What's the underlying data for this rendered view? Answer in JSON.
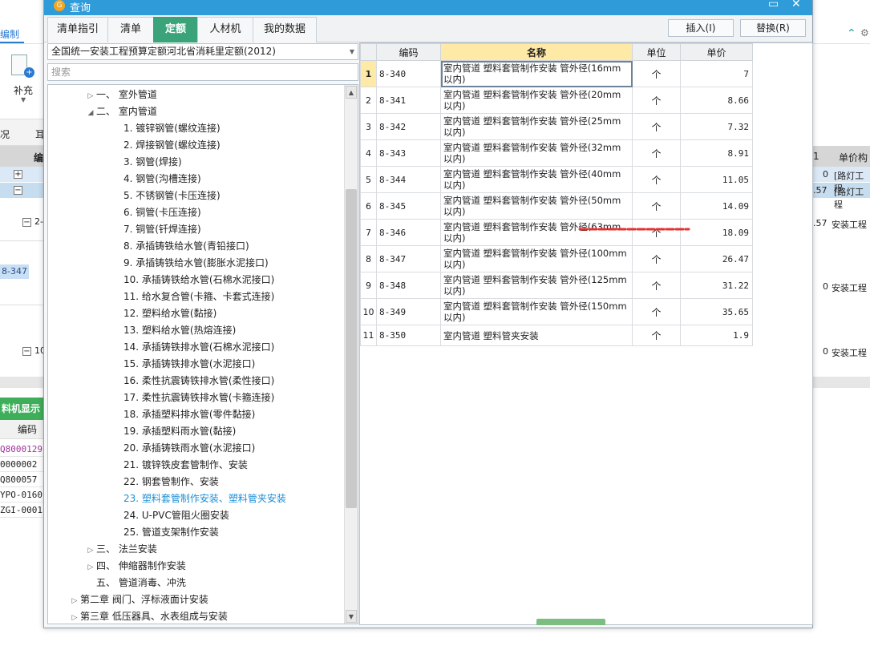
{
  "background": {
    "tab_label": "编制",
    "supplement_label": "补充",
    "band_text_1": "况",
    "band_text_2": "耳",
    "grid_header_code": "编",
    "selected_code": "8-347",
    "node_1": "2-",
    "node_2": "10",
    "material_panel_title": "料机显示",
    "material_code_header": "编码",
    "material_codes": [
      "Q8000129",
      "0000002",
      "Q800057",
      "YPO-0160",
      "ZGI-0001"
    ],
    "right_header_1": "1",
    "right_header_2": "单价构",
    "right_rows": [
      {
        "value": "0",
        "text": "[路灯工程"
      },
      {
        "value": ".57",
        "text": "[路灯工程"
      },
      {
        "value": ".57",
        "text": "安装工程"
      },
      {
        "value": "0",
        "text": "安装工程"
      },
      {
        "value": "0",
        "text": "安装工程"
      }
    ]
  },
  "dialog": {
    "title": "查询",
    "tabs": [
      {
        "label": "清单指引",
        "active": false
      },
      {
        "label": "清单",
        "active": false
      },
      {
        "label": "定额",
        "active": true
      },
      {
        "label": "人材机",
        "active": false
      },
      {
        "label": "我的数据",
        "active": false
      }
    ],
    "insert_button": "插入(I)",
    "replace_button": "替换(R)",
    "quota_library": "全国统一安装工程预算定额河北省消耗里定额(2012)",
    "search_placeholder": "搜索",
    "tree": [
      {
        "label": "一、 室外管道",
        "toggle": "collapsed",
        "selected": false
      },
      {
        "label": "二、 室内管道",
        "toggle": "expanded",
        "selected": false
      },
      {
        "label": "1.  镀锌钢管(螺纹连接)",
        "toggle": "none",
        "selected": false
      },
      {
        "label": "2.  焊接钢管(螺纹连接)",
        "toggle": "none",
        "selected": false
      },
      {
        "label": "3.  钢管(焊接)",
        "toggle": "none",
        "selected": false
      },
      {
        "label": "4.  钢管(沟槽连接)",
        "toggle": "none",
        "selected": false
      },
      {
        "label": "5.  不锈钢管(卡压连接)",
        "toggle": "none",
        "selected": false
      },
      {
        "label": "6.  铜管(卡压连接)",
        "toggle": "none",
        "selected": false
      },
      {
        "label": "7.  铜管(钎焊连接)",
        "toggle": "none",
        "selected": false
      },
      {
        "label": "8.  承插铸铁给水管(青铅接口)",
        "toggle": "none",
        "selected": false
      },
      {
        "label": "9.  承插铸铁给水管(膨胀水泥接口)",
        "toggle": "none",
        "selected": false
      },
      {
        "label": "10.  承插铸铁给水管(石棉水泥接口)",
        "toggle": "none",
        "selected": false
      },
      {
        "label": "11.  给水复合管(卡箍、卡套式连接)",
        "toggle": "none",
        "selected": false
      },
      {
        "label": "12.  塑料给水管(黏接)",
        "toggle": "none",
        "selected": false
      },
      {
        "label": "13.  塑料给水管(热熔连接)",
        "toggle": "none",
        "selected": false
      },
      {
        "label": "14.  承插铸铁排水管(石棉水泥接口)",
        "toggle": "none",
        "selected": false
      },
      {
        "label": "15.  承插铸铁排水管(水泥接口)",
        "toggle": "none",
        "selected": false
      },
      {
        "label": "16.  柔性抗震铸铁排水管(柔性接口)",
        "toggle": "none",
        "selected": false
      },
      {
        "label": "17.  柔性抗震铸铁排水管(卡箍连接)",
        "toggle": "none",
        "selected": false
      },
      {
        "label": "18.  承插塑料排水管(零件黏接)",
        "toggle": "none",
        "selected": false
      },
      {
        "label": "19.  承插塑料雨水管(黏接)",
        "toggle": "none",
        "selected": false
      },
      {
        "label": "20.  承插铸铁雨水管(水泥接口)",
        "toggle": "none",
        "selected": false
      },
      {
        "label": "21.  镀锌铁皮套管制作、安装",
        "toggle": "none",
        "selected": false
      },
      {
        "label": "22.  钢套管制作、安装",
        "toggle": "none",
        "selected": false
      },
      {
        "label": "23.  塑料套管制作安装、塑料管夹安装",
        "toggle": "none",
        "selected": true
      },
      {
        "label": "24.  U-PVC管阻火圈安装",
        "toggle": "none",
        "selected": false
      },
      {
        "label": "25.  管道支架制作安装",
        "toggle": "none",
        "selected": false
      },
      {
        "label": "三、 法兰安装",
        "toggle": "collapsed",
        "selected": false
      },
      {
        "label": "四、 伸缩器制作安装",
        "toggle": "collapsed",
        "selected": false
      },
      {
        "label": "五、 管道消毒、冲洗",
        "toggle": "none",
        "selected": false
      },
      {
        "label": "第二章 阀门、浮标液面计安装",
        "toggle": "collapsed",
        "selected": false
      },
      {
        "label": "第三章 低压器具、水表组成与安装",
        "toggle": "collapsed",
        "selected": false
      }
    ],
    "grid": {
      "headers": {
        "code": "编码",
        "name": "名称",
        "unit": "单位",
        "price": "单价"
      },
      "rows": [
        {
          "idx": "1",
          "code": "8-340",
          "name": "室内管道 塑料套管制作安装 管外径(16mm以内)",
          "unit": "个",
          "price": "7"
        },
        {
          "idx": "2",
          "code": "8-341",
          "name": "室内管道 塑料套管制作安装 管外径(20mm以内)",
          "unit": "个",
          "price": "8.66"
        },
        {
          "idx": "3",
          "code": "8-342",
          "name": "室内管道 塑料套管制作安装 管外径(25mm以内)",
          "unit": "个",
          "price": "7.32"
        },
        {
          "idx": "4",
          "code": "8-343",
          "name": "室内管道 塑料套管制作安装 管外径(32mm以内)",
          "unit": "个",
          "price": "8.91"
        },
        {
          "idx": "5",
          "code": "8-344",
          "name": "室内管道 塑料套管制作安装 管外径(40mm以内)",
          "unit": "个",
          "price": "11.05"
        },
        {
          "idx": "6",
          "code": "8-345",
          "name": "室内管道 塑料套管制作安装 管外径(50mm以内)",
          "unit": "个",
          "price": "14.09"
        },
        {
          "idx": "7",
          "code": "8-346",
          "name": "室内管道 塑料套管制作安装 管外径(63mm以内)",
          "unit": "个",
          "price": "18.09"
        },
        {
          "idx": "8",
          "code": "8-347",
          "name": "室内管道 塑料套管制作安装 管外径(100mm以内)",
          "unit": "个",
          "price": "26.47"
        },
        {
          "idx": "9",
          "code": "8-348",
          "name": "室内管道 塑料套管制作安装 管外径(125mm以内)",
          "unit": "个",
          "price": "31.22"
        },
        {
          "idx": "10",
          "code": "8-349",
          "name": "室内管道 塑料套管制作安装 管外径(150mm以内)",
          "unit": "个",
          "price": "35.65"
        },
        {
          "idx": "11",
          "code": "8-350",
          "name": "室内管道 塑料管夹安装",
          "unit": "个",
          "price": "1.9"
        }
      ]
    },
    "colors": {
      "titlebar": "#2f9bd8",
      "active_tab": "#3aa37a",
      "header_highlight": "#ffe9a6",
      "selected_tree_item": "#1e8fd6",
      "annotation_red": "#e53030"
    }
  }
}
